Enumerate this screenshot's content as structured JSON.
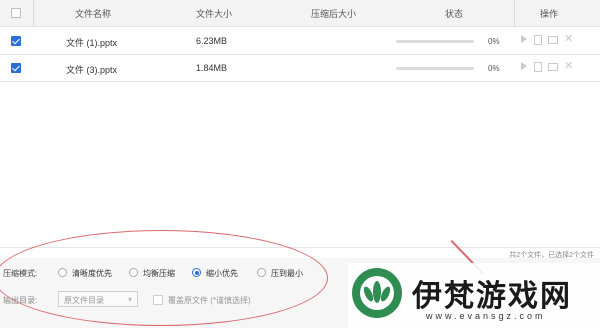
{
  "header": {
    "col_name": "文件名称",
    "col_size": "文件大小",
    "col_compressed": "压缩后大小",
    "col_status": "状态",
    "col_ops": "操作"
  },
  "files": [
    {
      "name": "文件 (1).pptx",
      "size": "6.23MB",
      "compressed": "",
      "progress": 0,
      "percent_text": "0%",
      "checked": true
    },
    {
      "name": "文件 (3).pptx",
      "size": "1.84MB",
      "compressed": "",
      "progress": 0,
      "percent_text": "0%",
      "checked": true
    }
  ],
  "summary": "共2个文件，已选择2个文件",
  "compress_mode": {
    "label": "压缩模式:",
    "options": [
      "清晰度优先",
      "均衡压缩",
      "缩小优先",
      "压到最小"
    ],
    "selected": "缩小优先"
  },
  "output": {
    "label": "输出目录:",
    "select_value": "原文件目录",
    "overwrite_label": "覆盖原文件 (*谨慎选择)"
  },
  "watermark": {
    "title": "伊梵游戏网",
    "url": "www.evansgz.com"
  },
  "colors": {
    "accent": "#2b6fd6",
    "annotation": "#d9686a",
    "logo": "#2f8d52"
  }
}
